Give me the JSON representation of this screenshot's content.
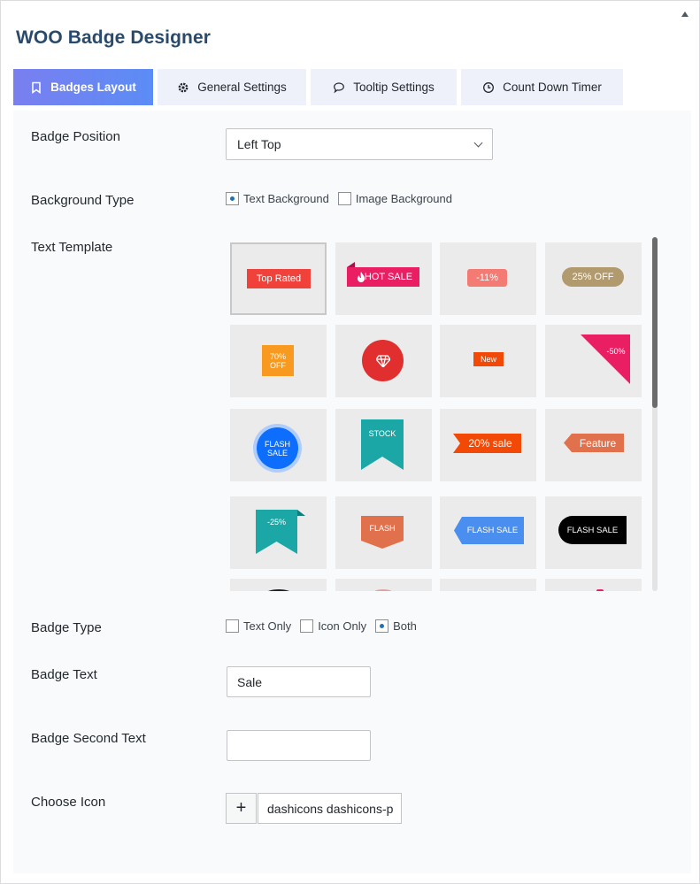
{
  "title": "WOO Badge Designer",
  "tabs": [
    {
      "label": "Badges Layout",
      "icon": "bookmark-icon"
    },
    {
      "label": "General Settings",
      "icon": "gear-icon"
    },
    {
      "label": "Tooltip Settings",
      "icon": "speech-bubble-icon"
    },
    {
      "label": "Count Down Timer",
      "icon": "clock-icon"
    }
  ],
  "badge_position": {
    "label": "Badge Position",
    "value": "Left Top"
  },
  "background_type": {
    "label": "Background Type",
    "options": [
      "Text Background",
      "Image Background"
    ],
    "selected": "Text Background"
  },
  "text_template": {
    "label": "Text Template",
    "templates": [
      "Top Rated",
      "HOT SALE",
      "-11%",
      "25% OFF",
      "70% OFF",
      "",
      "New",
      "-50%",
      "FLASH SALE",
      "STOCK",
      "20% sale",
      "Feature",
      "-25%",
      "FLASH",
      "FLASH SALE",
      "FLASH SALE"
    ],
    "colors": {
      "red": "#f0413a",
      "pink": "#e91e63",
      "salmon": "#f47a74",
      "tan": "#b19a6e",
      "orange": "#f89a1f",
      "crimson": "#e12f2f",
      "redorange": "#f24a06",
      "blue": "#0d6efd",
      "teal": "#1aa7a5",
      "coral": "#e0714c",
      "skyblue": "#4a8ef0",
      "black": "#000000"
    }
  },
  "badge_type": {
    "label": "Badge Type",
    "options": [
      "Text Only",
      "Icon Only",
      "Both"
    ],
    "selected": "Both"
  },
  "badge_text": {
    "label": "Badge Text",
    "value": "Sale"
  },
  "badge_second_text": {
    "label": "Badge Second Text",
    "value": ""
  },
  "choose_icon": {
    "label": "Choose Icon",
    "button": "+",
    "value": "dashicons dashicons-p"
  }
}
